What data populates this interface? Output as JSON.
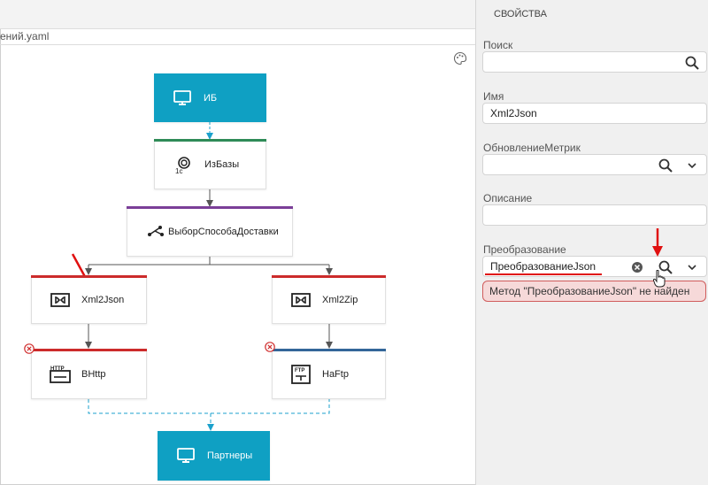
{
  "editor": {
    "filename": "ений.yaml"
  },
  "nodes": {
    "ib": "ИБ",
    "izbazy": "ИзБазы",
    "vybor": "ВыборСпособаДоставки",
    "xml2json": "Xml2Json",
    "xml2zip": "Xml2Zip",
    "vhttp": "ВHttp",
    "naftp": "НаFtp",
    "partnery": "Партнеры"
  },
  "properties": {
    "title": "СВОЙСТВА",
    "search_label": "Поиск",
    "search_value": "",
    "name_label": "Имя",
    "name_value": "Xml2Json",
    "metrics_label": "ОбновлениеМетрик",
    "metrics_value": "",
    "description_label": "Описание",
    "description_value": "",
    "transform_label": "Преобразование",
    "transform_value": "ПреобразованиеJson",
    "error_message": "Метод \"ПреобразованиеJson\" не найден"
  },
  "colors": {
    "teal": "#0fa0c3",
    "green": "#2e8b57",
    "purple": "#7b3f98",
    "red": "#cc2b2b",
    "blue": "#336699",
    "annotation_red": "#e01010"
  },
  "icons": [
    "monitor-icon",
    "1c-icon",
    "branch-icon",
    "xml-transform-icon",
    "http-icon",
    "ftp-icon",
    "error-icon",
    "search-icon",
    "chevron-down-icon",
    "clear-icon",
    "palette-icon",
    "hand-cursor-icon"
  ]
}
